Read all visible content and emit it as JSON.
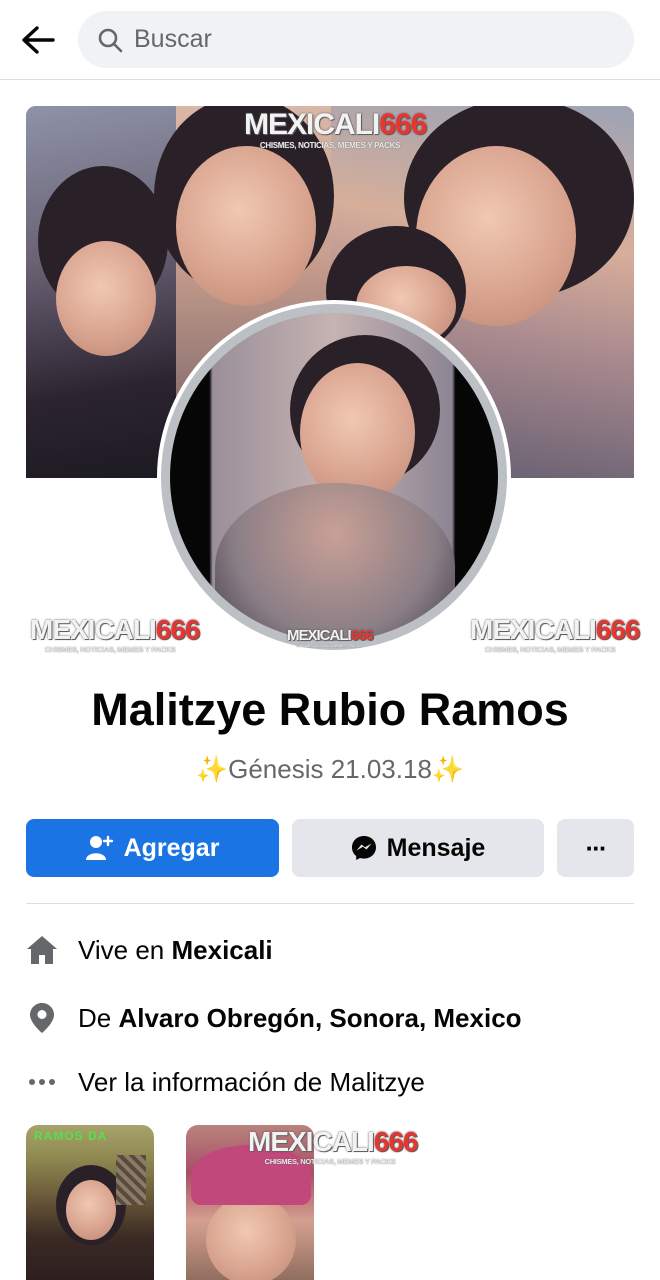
{
  "header": {
    "search_placeholder": "Buscar"
  },
  "watermark": {
    "brand": "MEXICALI",
    "number": "666",
    "tagline": "CHISMES, NOTICIAS, MEMES Y PACKS"
  },
  "profile": {
    "name": "Malitzye Rubio Ramos",
    "bio_sparkle": "✨",
    "bio_text": "Génesis 21.03.18"
  },
  "actions": {
    "add_label": "Agregar",
    "message_label": "Mensaje",
    "more_label": "···"
  },
  "info": {
    "lives_prefix": "Vive en ",
    "lives_city": "Mexicali",
    "from_prefix": "De ",
    "from_place": "Alvaro Obregón, Sonora, Mexico",
    "see_info": "Ver la información de Malitzye"
  },
  "photos": {
    "photo1_overlay": "RAMOS DA"
  },
  "colors": {
    "accent": "#1b74e4",
    "button_secondary": "#e4e6eb",
    "text_secondary": "#65676b",
    "watermark_red": "#e8352f"
  },
  "icons": [
    "back-arrow-icon",
    "search-icon",
    "add-friend-icon",
    "messenger-icon",
    "more-icon",
    "home-icon",
    "location-pin-icon",
    "ellipsis-icon"
  ]
}
